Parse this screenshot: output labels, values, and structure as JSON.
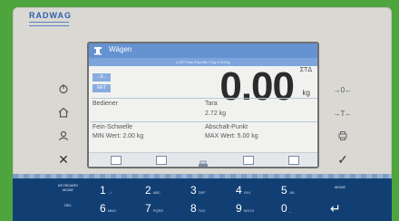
{
  "brand": {
    "logo_text": "RADWAG"
  },
  "screen": {
    "title": "Wägen",
    "subline": "|<007 Max 8 kg Min 0,5g e=0,01g",
    "chips": [
      "→0←",
      "NET"
    ],
    "weight_value": "0.00",
    "weight_unit": "kg",
    "stability_marker": "ΣTΔ",
    "rows": {
      "operator_label": "Bediener",
      "tare_label": "Tara",
      "tare_value": "2.72 kg",
      "fine_threshold_label": "Fein-Schwelle",
      "cutoff_point_label": "Abschalt-Punkt",
      "min_value": "MIN Wert: 2.00 kg",
      "max_value": "MAX Wert: 5.00 kg"
    }
  },
  "left_buttons": [
    {
      "icon": "power-icon"
    },
    {
      "icon": "home-icon"
    },
    {
      "icon": "user-icon"
    },
    {
      "icon": "close-icon",
      "glyph": "✕"
    }
  ],
  "right_buttons": [
    {
      "label": "→0←",
      "icon": "zero-icon"
    },
    {
      "label": "→T←",
      "icon": "tare-icon"
    },
    {
      "label": "",
      "icon": "print-icon"
    },
    {
      "label": "",
      "icon": "check-icon",
      "glyph": "✓"
    }
  ],
  "keyboard": {
    "row1": [
      {
        "label": "KEYBOARD MODE",
        "type": "func"
      },
      {
        "label": "1",
        "sub": ", ,!"
      },
      {
        "label": "2",
        "sub": "ABC"
      },
      {
        "label": "3",
        "sub": "DEF"
      },
      {
        "label": "4",
        "sub": "GHI"
      },
      {
        "label": "5",
        "sub": "JKL"
      },
      {
        "label": "MODE",
        "type": "func"
      }
    ],
    "row2": [
      {
        "label": "DEL",
        "type": "func"
      },
      {
        "label": "6",
        "sub": "MNO"
      },
      {
        "label": "7",
        "sub": "PQRS"
      },
      {
        "label": "8",
        "sub": "TUV"
      },
      {
        "label": "9",
        "sub": "WXYZ"
      },
      {
        "label": "0",
        "sub": "_"
      },
      {
        "label": "↵",
        "type": "func"
      }
    ]
  }
}
